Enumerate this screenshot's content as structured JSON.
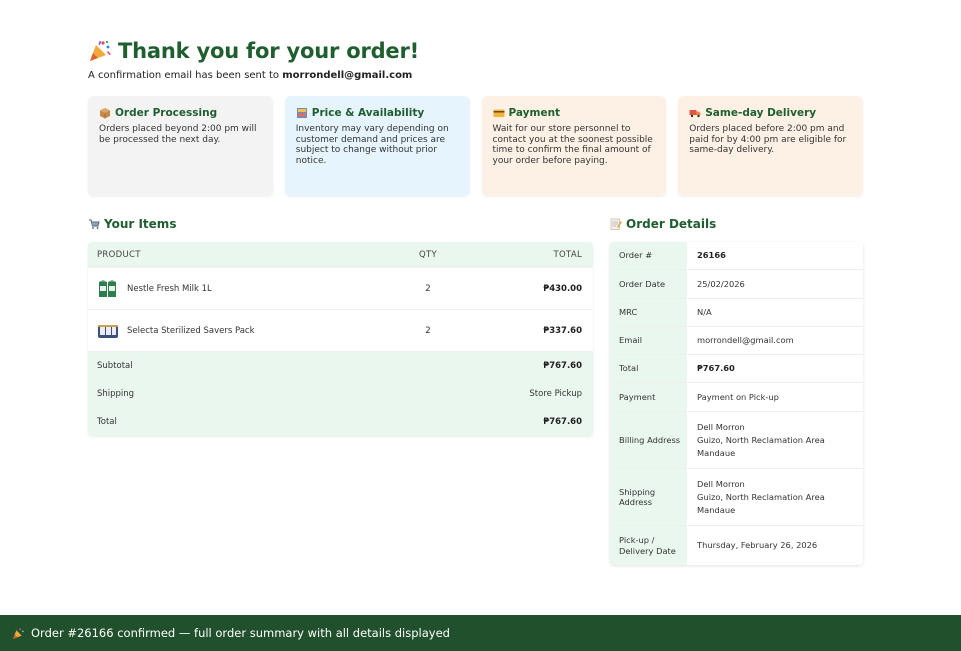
{
  "header": {
    "icon": "party-popper-icon",
    "title": "Thank you for your order!",
    "subtitle_prefix": "A confirmation email has been sent to ",
    "email": "morrondell@gmail.com"
  },
  "notices": [
    {
      "icon": "package-icon",
      "title": "Order Processing",
      "body": "Orders placed beyond 2:00 pm will be processed the next day.",
      "color": "#f3f3f3"
    },
    {
      "icon": "shelves-icon",
      "title": "Price & Availability",
      "body": "Inventory may vary depending on customer demand and prices are subject to change without prior notice.",
      "color": "#e6f4fd"
    },
    {
      "icon": "credit-card-icon",
      "title": "Payment",
      "body": "Wait for our store personnel to contact you at the soonest possible time to confirm the final amount of your order before paying.",
      "color": "#fdf1e6"
    },
    {
      "icon": "delivery-truck-icon",
      "title": "Same-day Delivery",
      "body": "Orders placed before 2:00 pm and paid for by 4:00 pm are eligible for same-day delivery.",
      "color": "#fdf1e6"
    }
  ],
  "items": {
    "icon": "cart-icon",
    "title": "Your Items",
    "columns": {
      "product": "PRODUCT",
      "qty": "QTY",
      "total": "TOTAL"
    },
    "rows": [
      {
        "name": "Nestle Fresh Milk 1L",
        "qty": "2",
        "total": "₱430.00",
        "thumb": "milk-carton-icon"
      },
      {
        "name": "Selecta Sterilized Savers Pack",
        "qty": "2",
        "total": "₱337.60",
        "thumb": "milk-pack-icon"
      }
    ],
    "summary": [
      {
        "label": "Subtotal",
        "value": "₱767.60",
        "bold": true
      },
      {
        "label": "Shipping",
        "value": "Store Pickup",
        "bold": false
      },
      {
        "label": "Total",
        "value": "₱767.60",
        "bold": true
      }
    ]
  },
  "details": {
    "icon": "memo-icon",
    "title": "Order Details",
    "rows": [
      {
        "label": "Order #",
        "lines": [
          "26166"
        ],
        "bold": true
      },
      {
        "label": "Order Date",
        "lines": [
          "25/02/2026"
        ],
        "bold": false
      },
      {
        "label": "MRC",
        "lines": [
          "N/A"
        ],
        "bold": false
      },
      {
        "label": "Email",
        "lines": [
          "morrondell@gmail.com"
        ],
        "bold": false
      },
      {
        "label": "Total",
        "lines": [
          "₱767.60"
        ],
        "bold": true
      },
      {
        "label": "Payment",
        "lines": [
          "Payment on Pick-up"
        ],
        "bold": false
      },
      {
        "label": "Billing Address",
        "lines": [
          "Dell Morron",
          "Guizo, North Reclamation Area",
          "Mandaue"
        ],
        "bold": false
      },
      {
        "label": "Shipping Address",
        "lines": [
          "Dell Morron",
          "Guizo, North Reclamation Area",
          "Mandaue"
        ],
        "bold": false
      },
      {
        "label": "Pick-up / Delivery Date",
        "lines": [
          "Thursday, February 26, 2026"
        ],
        "bold": false
      }
    ]
  },
  "footer": {
    "icon": "party-popper-icon",
    "text": "Order #26166 confirmed — full order summary with all details displayed"
  },
  "colors": {
    "brand_green": "#1f5e2e",
    "footer_green": "#21502d",
    "table_tint": "#eaf7ee"
  }
}
